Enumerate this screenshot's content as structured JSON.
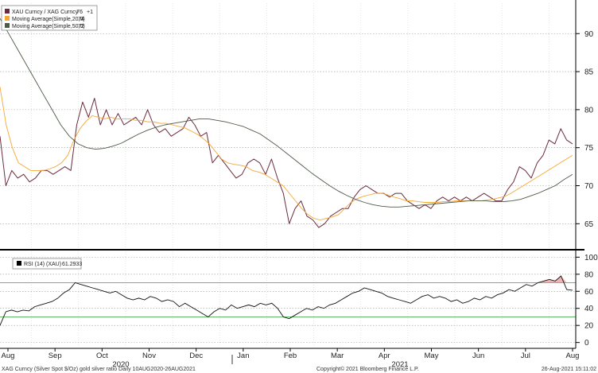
{
  "chart_data": [
    {
      "type": "line",
      "panel": "price",
      "ylim": [
        62,
        94
      ],
      "yticks": [
        65,
        70,
        75,
        80,
        85,
        90
      ],
      "grid": true,
      "legend_position": "top-left",
      "series": [
        {
          "name": "XAU Curncy / XAG Curncy",
          "legend_value": "76",
          "legend_suffix": "+1",
          "color": "#6b2b3c",
          "values": [
            76.5,
            70,
            72,
            71,
            71.5,
            70.5,
            71,
            72,
            72,
            71.5,
            72,
            72.5,
            72,
            78,
            81,
            79,
            81.5,
            78,
            80,
            78,
            79.5,
            78,
            78.5,
            79,
            78,
            80,
            78,
            77,
            77.5,
            76.5,
            77,
            77.5,
            79,
            78,
            76.5,
            77,
            73,
            74,
            73,
            72,
            71,
            71.5,
            73,
            73.5,
            73,
            71.5,
            73.5,
            71,
            69,
            65,
            67,
            68,
            66,
            65.5,
            64.5,
            65,
            66,
            66.5,
            67,
            67,
            68.5,
            69.5,
            70,
            69.5,
            69,
            69,
            68.5,
            69,
            69,
            68,
            67.5,
            67,
            67.5,
            67,
            68,
            68.5,
            68,
            68.5,
            68,
            68.5,
            68,
            68.5,
            69,
            68.5,
            68,
            68,
            69.5,
            70.5,
            72.5,
            72,
            71,
            73,
            74,
            76,
            75.5,
            77.5,
            76,
            75.5
          ]
        },
        {
          "name": "Moving Average(Simple,20,0)",
          "legend_value": "74",
          "color": "#f5a733",
          "values": [
            83,
            78,
            75,
            73,
            72.5,
            72,
            72,
            72,
            72.2,
            72.5,
            73,
            74,
            76,
            77.5,
            78.5,
            79.2,
            79,
            78.8,
            79,
            78.8,
            78.8,
            78.8,
            78.6,
            78.6,
            78.4,
            78.4,
            78.2,
            78.2,
            78,
            77.8,
            77.6,
            77.2,
            76.8,
            76.2,
            75.5,
            74.5,
            73.5,
            73,
            72.8,
            72.7,
            72.5,
            72,
            71.8,
            71.5,
            71,
            70.5,
            70,
            69,
            68,
            67,
            66.2,
            65.7,
            65.5,
            65.7,
            65.9,
            66.2,
            67,
            67.8,
            68.3,
            68.6,
            68.8,
            69,
            69,
            68.8,
            68.5,
            68.3,
            68,
            68,
            67.9,
            67.8,
            67.8,
            67.8,
            67.9,
            67.9,
            68,
            68,
            68,
            68,
            68,
            68.1,
            68.2,
            68.4,
            68.6,
            69,
            69.5,
            70,
            70.5,
            71,
            71.5,
            72,
            72.5,
            73,
            73.5,
            74
          ]
        },
        {
          "name": "Moving Average(Simple,50,0)",
          "legend_value": "72",
          "color": "#4d5a47",
          "values": [
            92,
            90,
            88,
            86,
            84,
            82,
            80,
            78,
            76.5,
            75.5,
            75,
            74.8,
            74.9,
            75.2,
            75.6,
            76.2,
            76.8,
            77.3,
            77.7,
            78,
            78.2,
            78.4,
            78.6,
            78.8,
            78.8,
            78.6,
            78.4,
            78.1,
            77.8,
            77.3,
            76.8,
            76,
            75.2,
            74.3,
            73.4,
            72.5,
            71.6,
            70.8,
            70,
            69.3,
            68.7,
            68.2,
            67.8,
            67.5,
            67.3,
            67.2,
            67.2,
            67.3,
            67.4,
            67.5,
            67.6,
            67.7,
            67.8,
            67.9,
            68,
            68,
            68,
            67.9,
            67.9,
            68,
            68.2,
            68.6,
            69,
            69.5,
            70,
            70.8,
            71.5
          ]
        }
      ]
    },
    {
      "type": "line",
      "panel": "rsi",
      "ylim": [
        -5,
        105
      ],
      "yticks": [
        0,
        20,
        40,
        60,
        80,
        100
      ],
      "reference_lines": [
        {
          "value": 70,
          "color": "#d86a6a"
        },
        {
          "value": 30,
          "color": "#4caf50"
        }
      ],
      "legend_position": "top-left",
      "series": [
        {
          "name": "RSI (14) (XAU)",
          "legend_value": "61.2933",
          "color": "#111111",
          "values": [
            20,
            36,
            38,
            36,
            38,
            37,
            42,
            44,
            46,
            48,
            52,
            58,
            62,
            70,
            68,
            66,
            64,
            62,
            60,
            58,
            60,
            56,
            52,
            50,
            52,
            50,
            54,
            52,
            48,
            50,
            48,
            42,
            46,
            42,
            38,
            34,
            30,
            36,
            40,
            38,
            44,
            40,
            42,
            44,
            42,
            46,
            44,
            46,
            40,
            30,
            28,
            32,
            36,
            40,
            38,
            42,
            40,
            44,
            46,
            50,
            54,
            58,
            60,
            64,
            62,
            60,
            58,
            54,
            52,
            50,
            48,
            46,
            50,
            54,
            56,
            52,
            54,
            52,
            48,
            50,
            46,
            48,
            52,
            50,
            54,
            52,
            56,
            58,
            62,
            60,
            64,
            68,
            66,
            70,
            72,
            74,
            72,
            78,
            62,
            61.3
          ]
        }
      ],
      "highlight": {
        "above": 70,
        "color": "#e8a1a1"
      }
    }
  ],
  "xaxis": {
    "months": [
      "Aug",
      "Sep",
      "Oct",
      "Nov",
      "Dec",
      "Jan",
      "Feb",
      "Mar",
      "Apr",
      "May",
      "Jun",
      "Jul",
      "Aug"
    ],
    "years": [
      "2020",
      "2021"
    ]
  },
  "footer": {
    "left": "XAG Curncy (Silver Spot $/Oz) gold silver ratio  Daily 10AUG2020-26AUG2021",
    "center": "Copyright© 2021 Bloomberg Finance L.P.",
    "right": "26-Aug-2021 15:11:02"
  }
}
